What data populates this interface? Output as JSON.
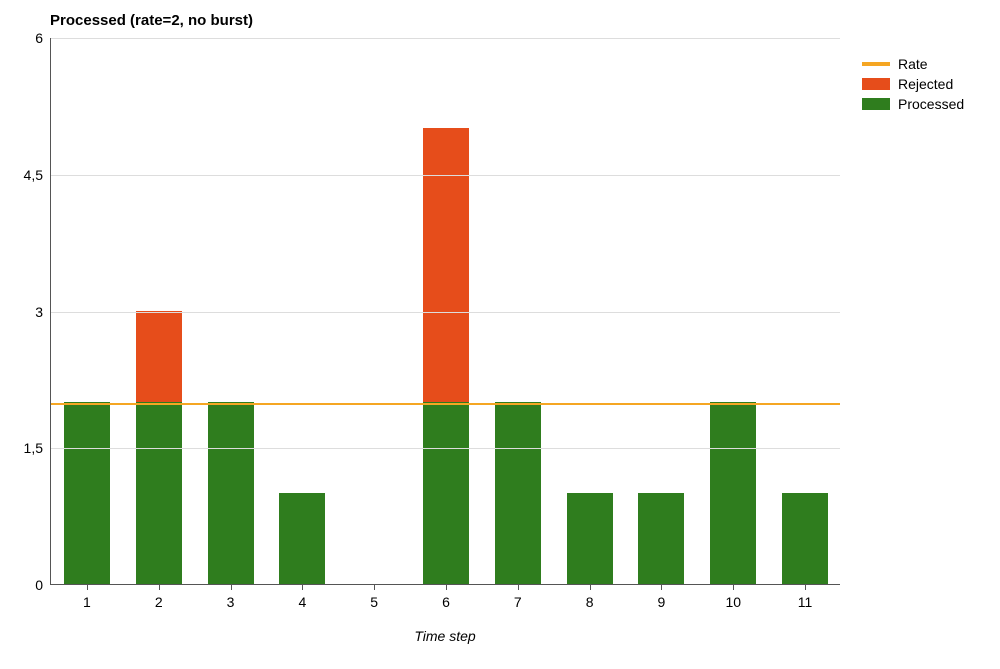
{
  "chart_data": {
    "type": "bar",
    "title": "Processed (rate=2, no burst)",
    "xlabel": "Time step",
    "ylabel": "",
    "ylim": [
      0,
      6
    ],
    "yticks": [
      0,
      1.5,
      3,
      4.5,
      6
    ],
    "ytick_labels": [
      "0",
      "1,5",
      "3",
      "4,5",
      "6"
    ],
    "categories": [
      "1",
      "2",
      "3",
      "4",
      "5",
      "6",
      "7",
      "8",
      "9",
      "10",
      "11"
    ],
    "series": [
      {
        "name": "Processed",
        "color": "#2f7d1e",
        "values": [
          2,
          2,
          2,
          1,
          0,
          2,
          2,
          1,
          1,
          2,
          1
        ]
      },
      {
        "name": "Rejected",
        "color": "#e64d1b",
        "values": [
          0,
          1,
          0,
          0,
          0,
          3,
          0,
          0,
          0,
          0,
          0
        ]
      }
    ],
    "rate_line": {
      "name": "Rate",
      "value": 2,
      "color": "#f5a623"
    },
    "legend": [
      "Rate",
      "Rejected",
      "Processed"
    ]
  }
}
